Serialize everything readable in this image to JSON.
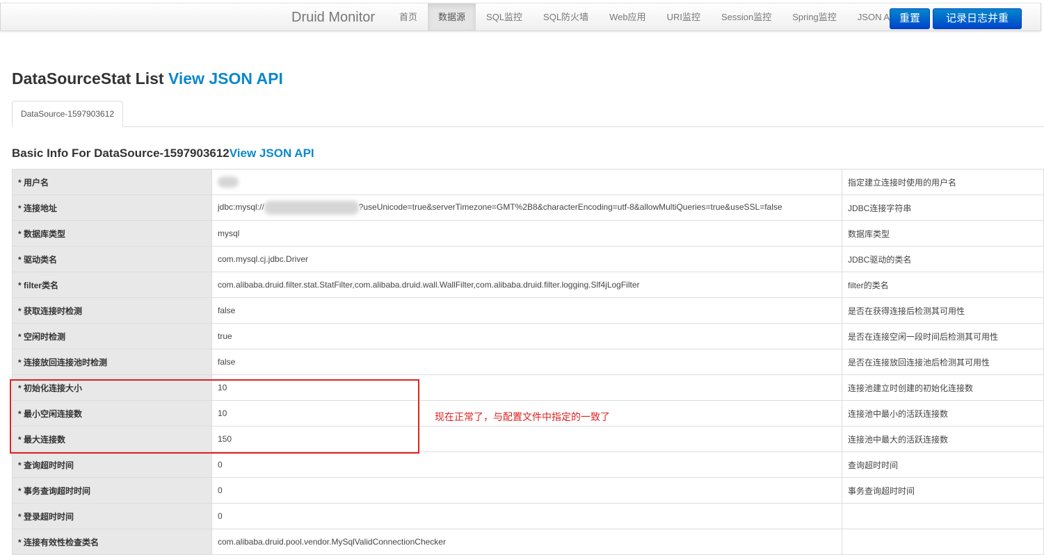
{
  "navbar": {
    "brand": "Druid Monitor",
    "items": [
      {
        "label": "首页"
      },
      {
        "label": "数据源"
      },
      {
        "label": "SQL监控"
      },
      {
        "label": "SQL防火墙"
      },
      {
        "label": "Web应用"
      },
      {
        "label": "URI监控"
      },
      {
        "label": "Session监控"
      },
      {
        "label": "Spring监控"
      },
      {
        "label": "JSON API"
      }
    ],
    "active_index": 1,
    "reset_label": "重置",
    "log_reset_label": "记录日志并重置",
    "accent": "#0066cc"
  },
  "page": {
    "title": "DataSourceStat List",
    "title_link": "View JSON API"
  },
  "tabs": [
    {
      "label": "DataSource-1597903612"
    }
  ],
  "section": {
    "title": "Basic Info For DataSource-1597903612",
    "link": "View JSON API"
  },
  "rows": [
    {
      "label": "* 用户名",
      "value": "",
      "desc": "指定建立连接时使用的用户名"
    },
    {
      "label": "* 连接地址",
      "value_prefix": "jdbc:mysql://",
      "value": "?useUnicode=true&serverTimezone=GMT%2B8&characterEncoding=utf-8&allowMultiQueries=true&useSSL=false",
      "desc": "JDBC连接字符串"
    },
    {
      "label": "* 数据库类型",
      "value": "mysql",
      "desc": "数据库类型"
    },
    {
      "label": "* 驱动类名",
      "value": "com.mysql.cj.jdbc.Driver",
      "desc": "JDBC驱动的类名"
    },
    {
      "label": "* filter类名",
      "value": "com.alibaba.druid.filter.stat.StatFilter,com.alibaba.druid.wall.WallFilter,com.alibaba.druid.filter.logging.Slf4jLogFilter",
      "desc": "filter的类名"
    },
    {
      "label": "* 获取连接时检测",
      "value": "false",
      "desc": "是否在获得连接后检测其可用性"
    },
    {
      "label": "* 空闲时检测",
      "value": "true",
      "desc": "是否在连接空闲一段时间后检测其可用性"
    },
    {
      "label": "* 连接放回连接池时检测",
      "value": "false",
      "desc": "是否在连接放回连接池后检测其可用性"
    },
    {
      "label": "* 初始化连接大小",
      "value": "10",
      "desc": "连接池建立时创建的初始化连接数"
    },
    {
      "label": "* 最小空闲连接数",
      "value": "10",
      "desc": "连接池中最小的活跃连接数"
    },
    {
      "label": "* 最大连接数",
      "value": "150",
      "desc": "连接池中最大的活跃连接数"
    },
    {
      "label": "* 查询超时时间",
      "value": "0",
      "desc": "查询超时时间"
    },
    {
      "label": "* 事务查询超时时间",
      "value": "0",
      "desc": "事务查询超时时间"
    },
    {
      "label": "* 登录超时时间",
      "value": "0",
      "desc": ""
    },
    {
      "label": "* 连接有效性检查类名",
      "value": "com.alibaba.druid.pool.vendor.MySqlValidConnectionChecker",
      "desc": ""
    }
  ],
  "annotation": {
    "text": "现在正常了，与配置文件中指定的一致了",
    "color": "#e02020"
  }
}
